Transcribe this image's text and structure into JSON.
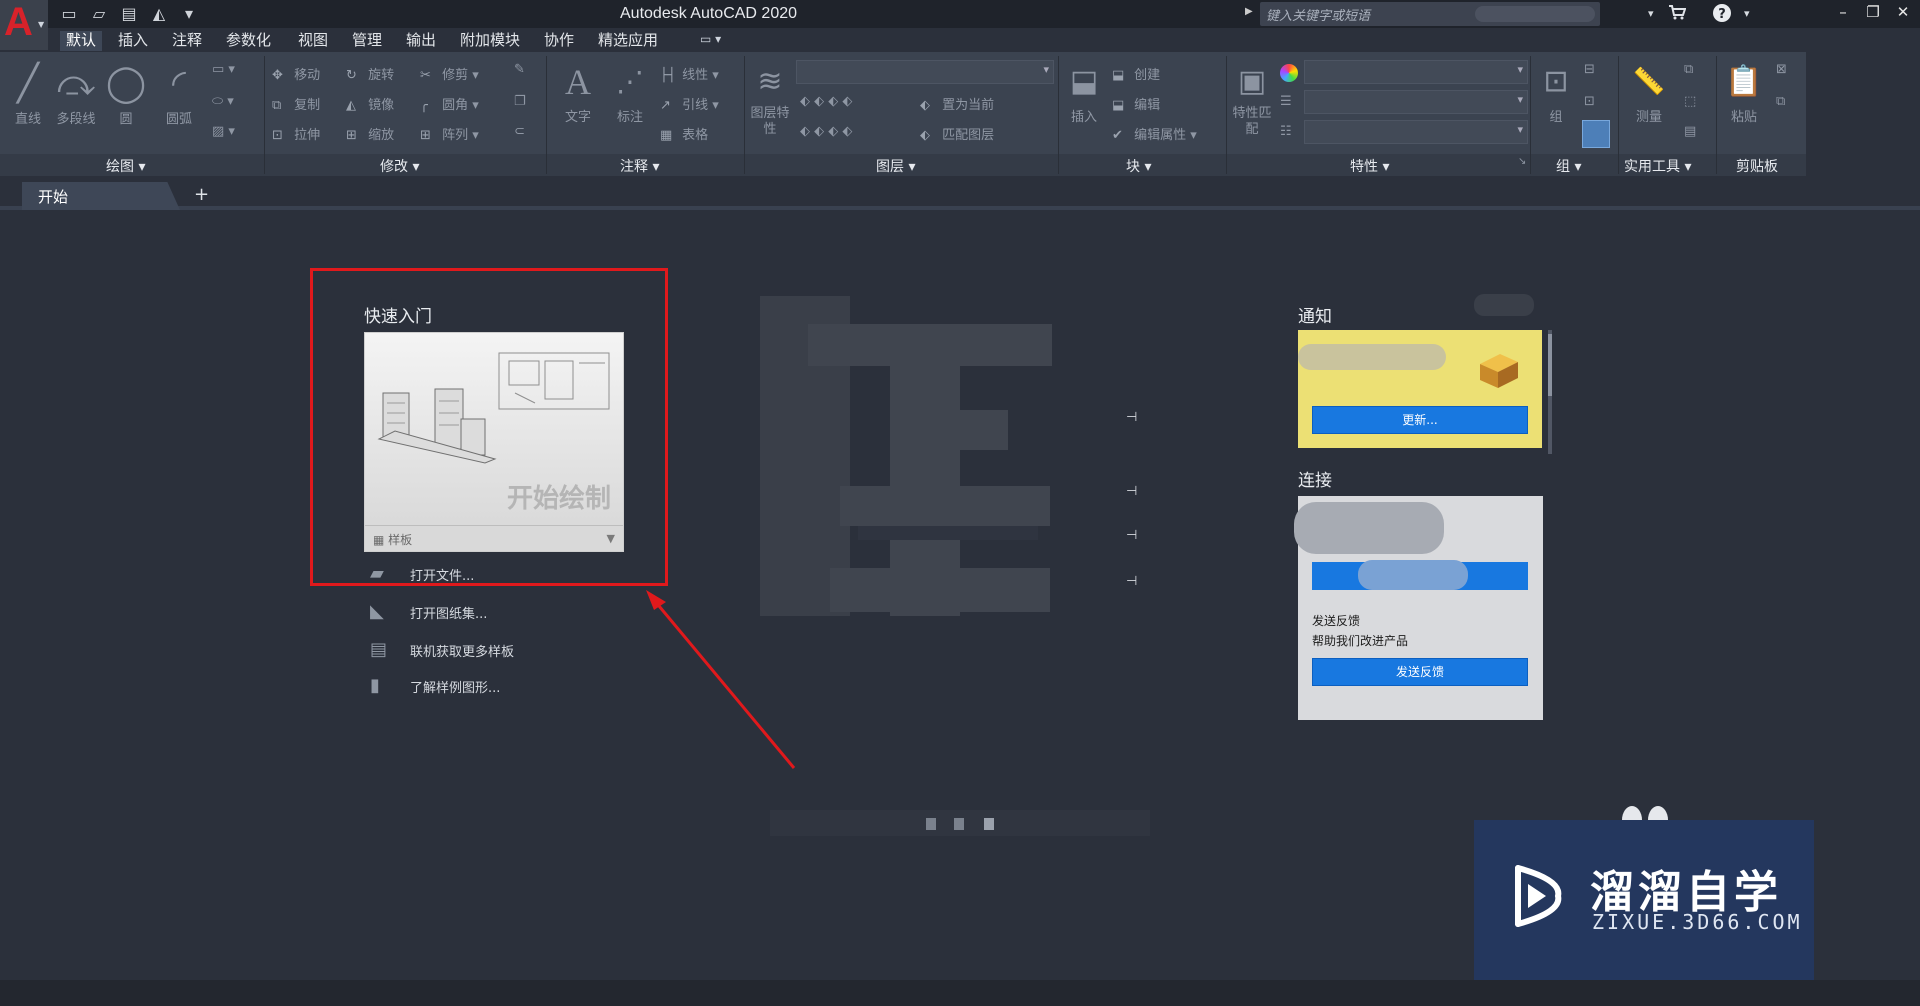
{
  "app": {
    "title": "Autodesk AutoCAD 2020",
    "logo_letter": "A",
    "search_placeholder": "键入关键字或短语"
  },
  "menu": {
    "items": [
      "默认",
      "插入",
      "注释",
      "参数化",
      "视图",
      "管理",
      "输出",
      "附加模块",
      "协作",
      "精选应用"
    ],
    "active_index": 0
  },
  "ribbon": {
    "draw": {
      "label": "绘图",
      "tools": [
        "直线",
        "多段线",
        "圆",
        "圆弧"
      ]
    },
    "modify": {
      "label": "修改",
      "tools": [
        "移动",
        "旋转",
        "修剪",
        "复制",
        "镜像",
        "圆角",
        "拉伸",
        "缩放",
        "阵列"
      ]
    },
    "annotation": {
      "label": "注释",
      "tools": [
        "文字",
        "标注",
        "线性",
        "引线",
        "表格"
      ]
    },
    "layers": {
      "label": "图层",
      "tools": [
        "图层特性",
        "置为当前",
        "匹配图层"
      ]
    },
    "block": {
      "label": "块",
      "tools": [
        "插入",
        "创建",
        "编辑",
        "编辑属性"
      ]
    },
    "properties": {
      "label": "特性",
      "tools": [
        "特性匹配"
      ]
    },
    "groups": {
      "label": "组",
      "tools": [
        "组"
      ]
    },
    "utilities": {
      "label": "实用工具",
      "tools": [
        "测量"
      ]
    },
    "clipboard": {
      "label": "剪贴板",
      "tools": [
        "粘贴"
      ]
    }
  },
  "tabs": {
    "start": "开始",
    "add": "+"
  },
  "quick_start": {
    "title": "快速入门",
    "card_caption": "开始绘制",
    "template_label": "样板",
    "links": [
      "打开文件...",
      "打开图纸集...",
      "联机获取更多样板",
      "了解样例图形..."
    ]
  },
  "notifications": {
    "title": "通知",
    "update_button": "更新..."
  },
  "connect": {
    "title": "连接",
    "feedback_title": "发送反馈",
    "feedback_sub": "帮助我们改进产品",
    "feedback_button": "发送反馈"
  },
  "watermark": {
    "cn": "溜溜自学",
    "en": "ZIXUE.3D66.COM"
  },
  "colors": {
    "accent_blue": "#1878e0",
    "highlight_red": "#e0191c",
    "notice_yellow": "#ece074"
  }
}
